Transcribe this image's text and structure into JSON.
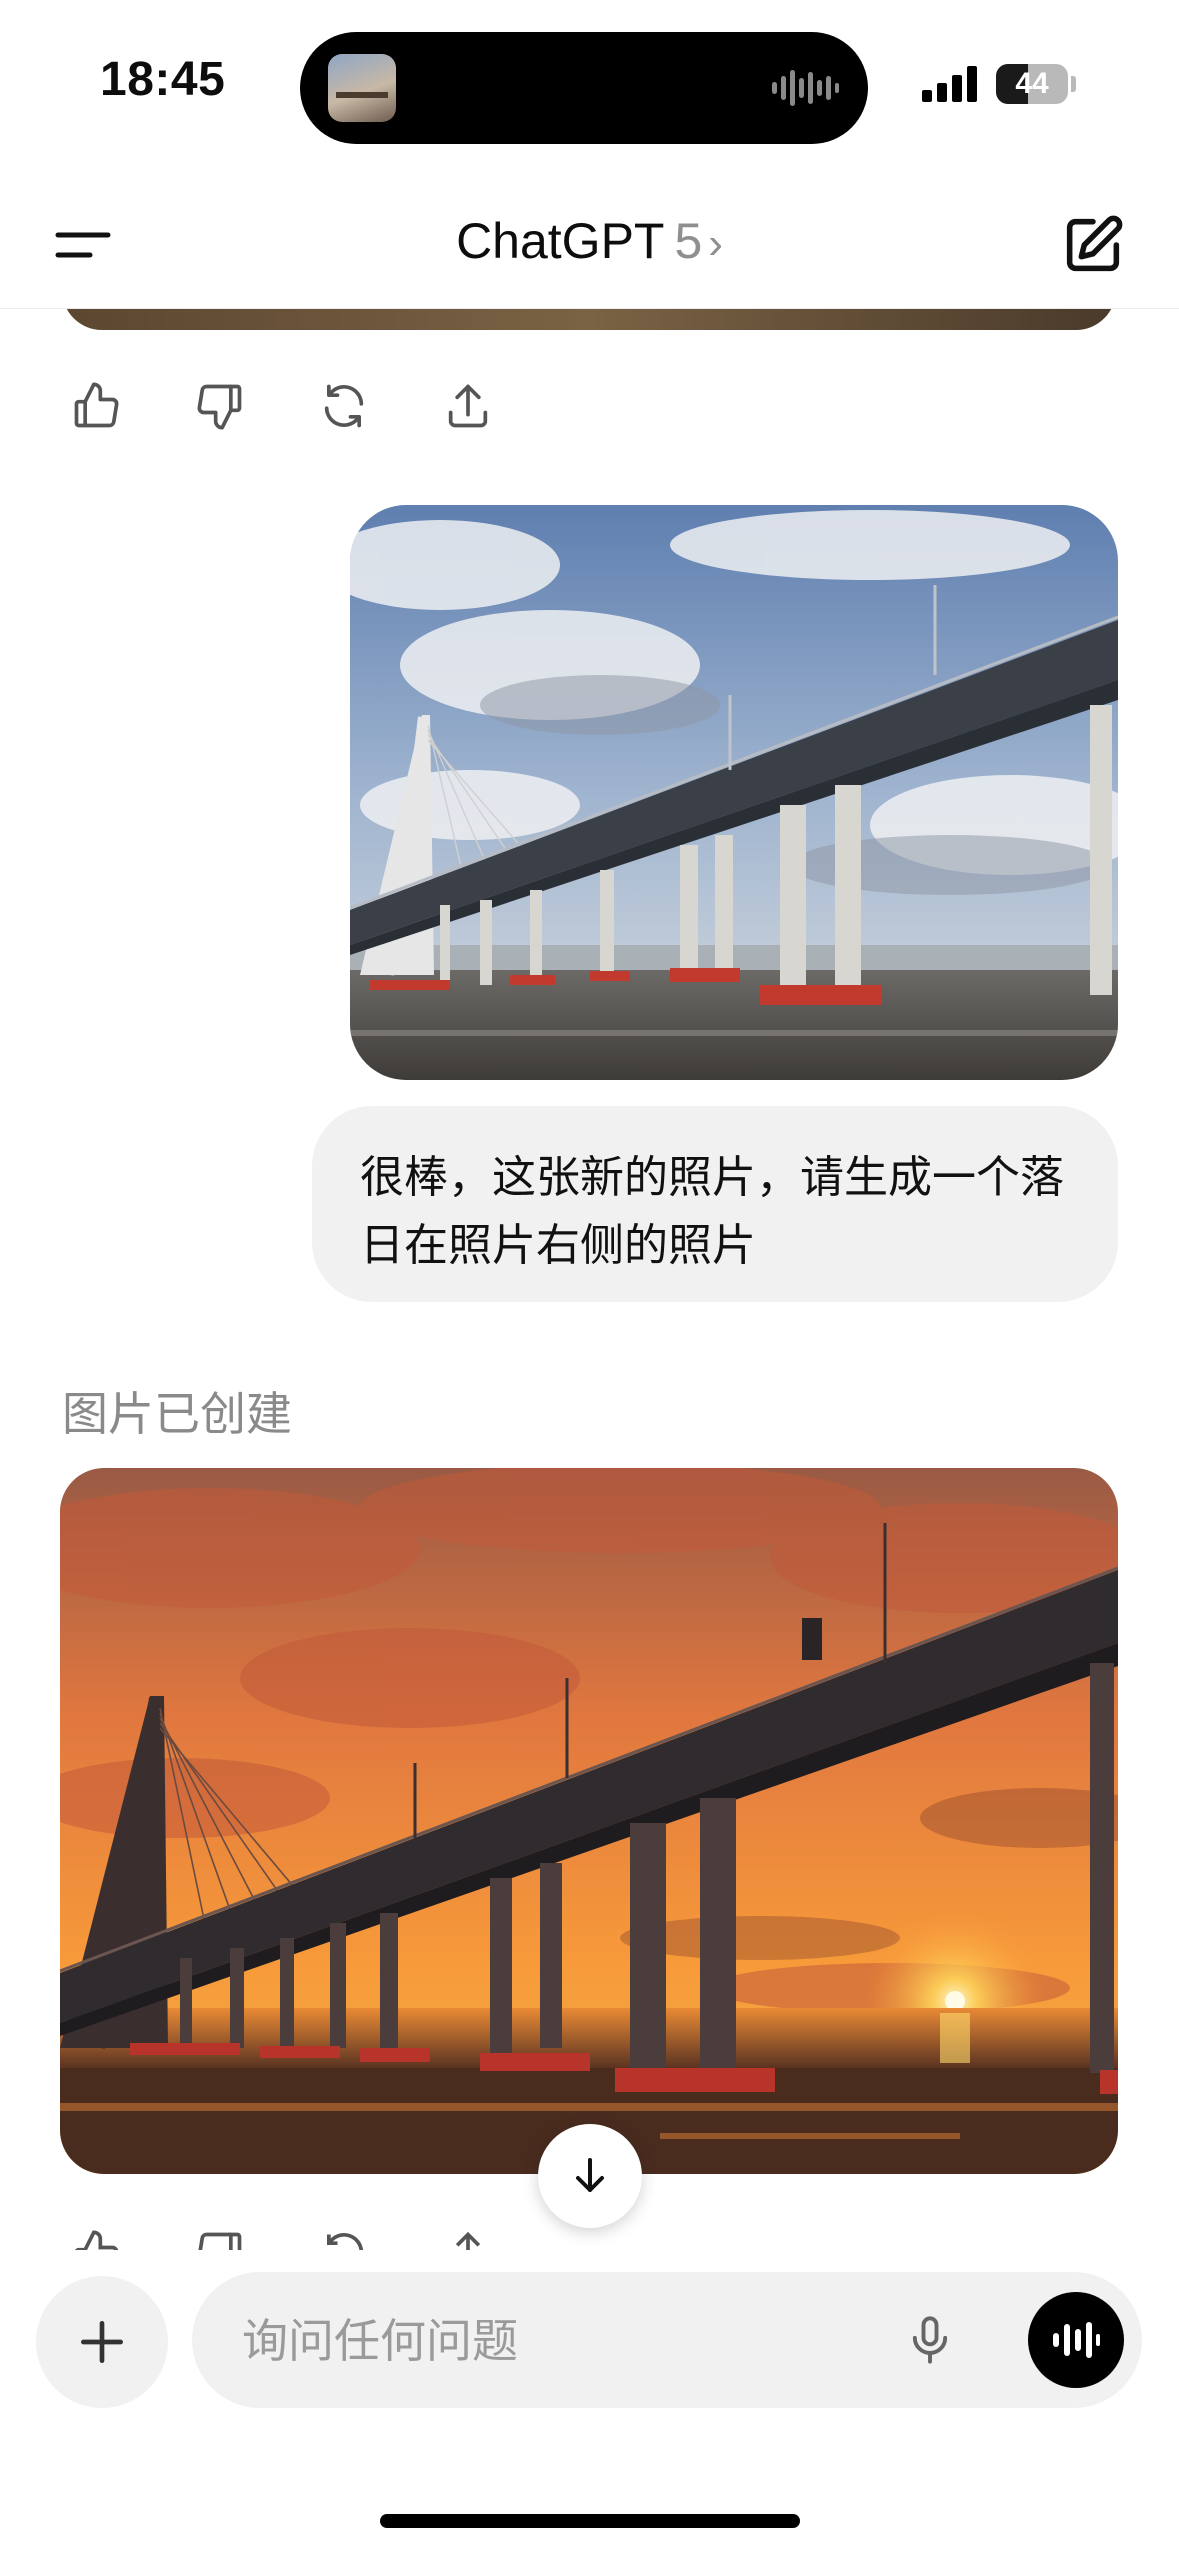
{
  "status_bar": {
    "time": "18:45",
    "battery": "44",
    "battery_level": 0.44
  },
  "header": {
    "app_name": "ChatGPT",
    "model_version": "5",
    "chevron": "›"
  },
  "conversation": {
    "user_message": "很棒，这张新的照片，请生成一个落日在照片右侧的照片",
    "assistant_status": "图片已创建"
  },
  "composer": {
    "placeholder": "询问任何问题"
  },
  "icons": {
    "menu": "menu-icon",
    "new_chat": "compose-icon",
    "like": "thumbs-up-icon",
    "dislike": "thumbs-down-icon",
    "regenerate": "refresh-icon",
    "share": "share-icon",
    "scroll_down": "arrow-down-icon",
    "attach": "plus-icon",
    "mic": "mic-icon",
    "voice": "voice-waveform-icon"
  },
  "colors": {
    "bubble_bg": "#f1f1f1",
    "muted_text": "#8a8a8a",
    "accent_black": "#000000"
  }
}
